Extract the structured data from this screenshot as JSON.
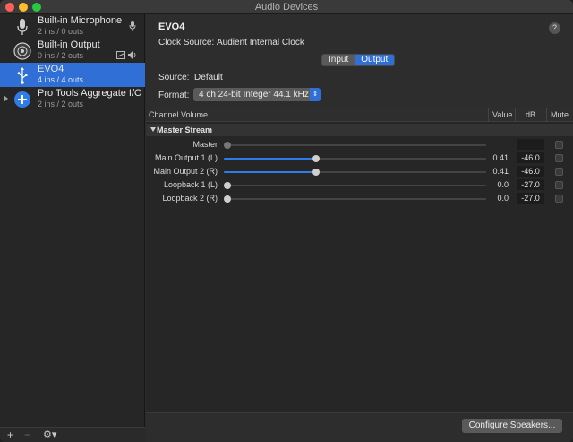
{
  "window": {
    "title": "Audio Devices"
  },
  "sidebar": {
    "devices": [
      {
        "name": "Built-in Microphone",
        "sub": "2 ins / 0 outs",
        "icon": "microphone-icon",
        "badge": "mic"
      },
      {
        "name": "Built-in Output",
        "sub": "0 ins / 2 outs",
        "icon": "speaker-icon",
        "badge": "volume"
      },
      {
        "name": "EVO4",
        "sub": "4 ins / 4 outs",
        "icon": "usb-icon",
        "selected": true
      },
      {
        "name": "Pro Tools Aggregate I/O",
        "sub": "2 ins / 2 outs",
        "icon": "aggregate-plus-icon"
      }
    ],
    "footer": {
      "add": "+",
      "remove": "−",
      "gear": "⚙︎▾"
    }
  },
  "main": {
    "device_title": "EVO4",
    "clock_source_label": "Clock Source:",
    "clock_source_value": "Audient Internal Clock",
    "tabs": {
      "input": "Input",
      "output": "Output",
      "selected": "Output"
    },
    "source_label": "Source:",
    "source_value": "Default",
    "format_label": "Format:",
    "format_value": "4 ch 24-bit Integer 44.1 kHz",
    "help": "?",
    "table": {
      "headers": {
        "channel": "Channel Volume",
        "value": "Value",
        "db": "dB",
        "mute": "Mute"
      },
      "section": "Master Stream",
      "rows": [
        {
          "label": "Master",
          "value": "",
          "db": "",
          "level": 0,
          "active": false
        },
        {
          "label": "Main Output 1 (L)",
          "value": "0.41",
          "db": "-46.0",
          "level": 0.41,
          "active": true
        },
        {
          "label": "Main Output 2 (R)",
          "value": "0.41",
          "db": "-46.0",
          "level": 0.41,
          "active": true
        },
        {
          "label": "Loopback 1 (L)",
          "value": "0.0",
          "db": "-27.0",
          "level": 0,
          "active": true
        },
        {
          "label": "Loopback 2 (R)",
          "value": "0.0",
          "db": "-27.0",
          "level": 0,
          "active": true
        }
      ]
    },
    "configure_button": "Configure Speakers..."
  },
  "colors": {
    "accent": "#2f6fd6",
    "slider_fill": "#2f7be8"
  }
}
